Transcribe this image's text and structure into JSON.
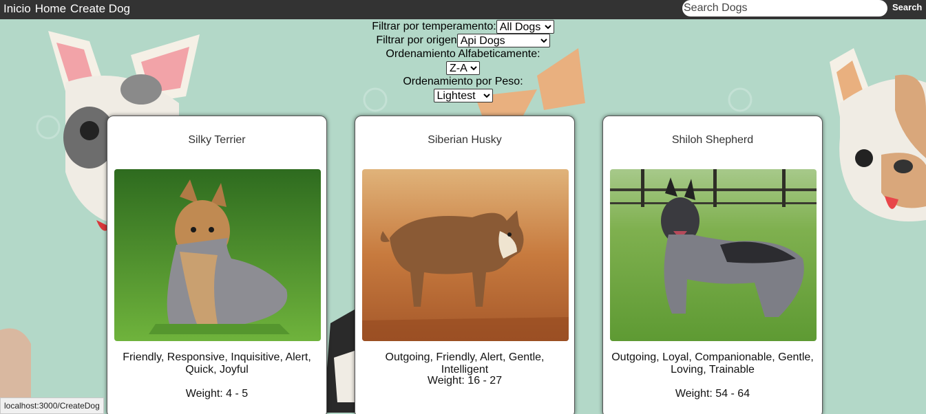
{
  "navbar": {
    "links": [
      "Inicio",
      "Home",
      "Create Dog"
    ],
    "search_placeholder": "Search Dogs",
    "search_button": "Search"
  },
  "filters": {
    "temperament_label": "Filtrar por temperamento:",
    "temperament_value": "All Dogs",
    "origin_label": "Filtrar por origen",
    "origin_value": "Api Dogs",
    "alpha_label": "Ordenamiento Alfabeticamente:",
    "alpha_value": "Z-A",
    "weight_label": "Ordenamiento por Peso:",
    "weight_value": "Lightest"
  },
  "cards": [
    {
      "name": "Silky Terrier",
      "temperaments": "Friendly, Responsive, Inquisitive, Alert, Quick, Joyful",
      "weight": "Weight: 4 - 5"
    },
    {
      "name": "Siberian Husky",
      "temperaments": "Outgoing, Friendly, Alert, Gentle, Intelligent",
      "weight": "Weight: 16 - 27"
    },
    {
      "name": "Shiloh Shepherd",
      "temperaments": "Outgoing, Loyal, Companionable, Gentle, Loving, Trainable",
      "weight": "Weight: 54 - 64"
    }
  ],
  "status_bar": "localhost:3000/CreateDog",
  "colors": {
    "navbar": "#333333",
    "background": "#b3d8c8",
    "card": "#ffffff"
  }
}
